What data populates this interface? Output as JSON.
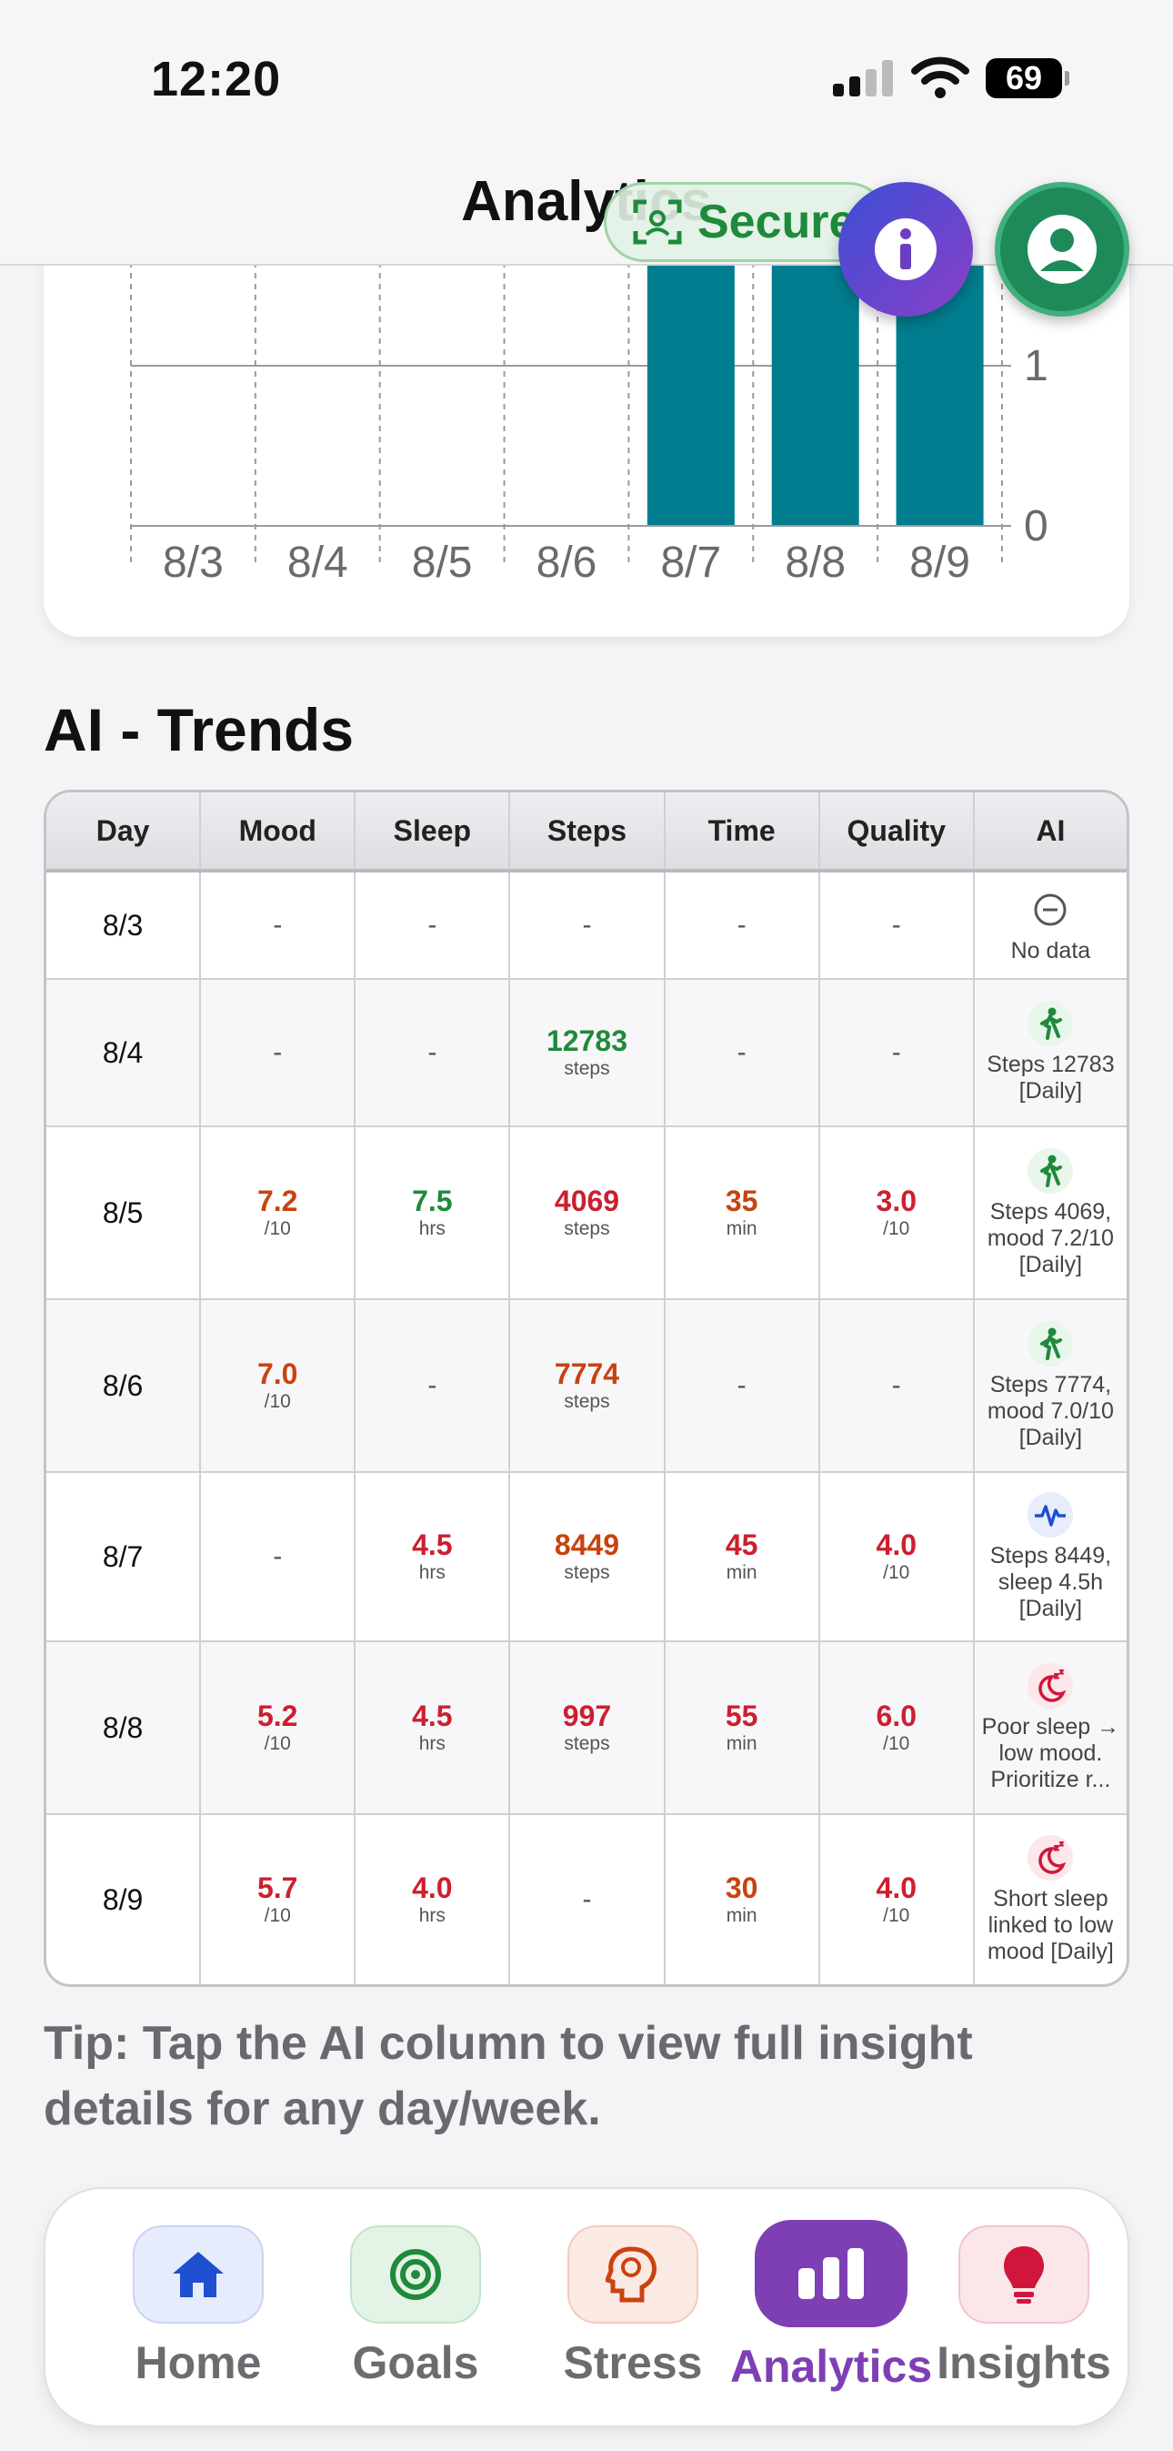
{
  "status_bar": {
    "time": "12:20",
    "battery": "69"
  },
  "header": {
    "title": "Analytics",
    "secure_label": "Secure"
  },
  "chart_data": {
    "type": "bar",
    "categories": [
      "8/3",
      "8/4",
      "8/5",
      "8/6",
      "8/7",
      "8/8",
      "8/9"
    ],
    "values": [
      0,
      0,
      0,
      0,
      2,
      2,
      2
    ],
    "y_ticks": [
      "0",
      "1"
    ],
    "ylim": [
      0,
      2
    ],
    "color": "#007d8f",
    "grid": true
  },
  "section_title": "AI - Trends",
  "table": {
    "headers": [
      "Day",
      "Mood",
      "Sleep",
      "Steps",
      "Time",
      "Quality",
      "AI"
    ],
    "rows": [
      {
        "day": "8/3",
        "mood": {
          "value": "-",
          "unit": "",
          "color": "dash"
        },
        "sleep": {
          "value": "-",
          "unit": "",
          "color": "dash"
        },
        "steps": {
          "value": "-",
          "unit": "",
          "color": "dash"
        },
        "time": {
          "value": "-",
          "unit": "",
          "color": "dash"
        },
        "quality": {
          "value": "-",
          "unit": "",
          "color": "dash"
        },
        "ai": {
          "icon": "no-data-icon",
          "text": "No data"
        }
      },
      {
        "day": "8/4",
        "mood": {
          "value": "-",
          "unit": "",
          "color": "dash"
        },
        "sleep": {
          "value": "-",
          "unit": "",
          "color": "dash"
        },
        "steps": {
          "value": "12783",
          "unit": "steps",
          "color": "green"
        },
        "time": {
          "value": "-",
          "unit": "",
          "color": "dash"
        },
        "quality": {
          "value": "-",
          "unit": "",
          "color": "dash"
        },
        "ai": {
          "icon": "walking-icon",
          "text": "Steps 12783 [Daily]"
        }
      },
      {
        "day": "8/5",
        "mood": {
          "value": "7.2",
          "unit": "/10",
          "color": "orange"
        },
        "sleep": {
          "value": "7.5",
          "unit": "hrs",
          "color": "green"
        },
        "steps": {
          "value": "4069",
          "unit": "steps",
          "color": "red"
        },
        "time": {
          "value": "35",
          "unit": "min",
          "color": "orange"
        },
        "quality": {
          "value": "3.0",
          "unit": "/10",
          "color": "red"
        },
        "ai": {
          "icon": "walking-icon",
          "text": "Steps 4069, mood 7.2/10 [Daily]"
        }
      },
      {
        "day": "8/6",
        "mood": {
          "value": "7.0",
          "unit": "/10",
          "color": "orange"
        },
        "sleep": {
          "value": "-",
          "unit": "",
          "color": "dash"
        },
        "steps": {
          "value": "7774",
          "unit": "steps",
          "color": "orange"
        },
        "time": {
          "value": "-",
          "unit": "",
          "color": "dash"
        },
        "quality": {
          "value": "-",
          "unit": "",
          "color": "dash"
        },
        "ai": {
          "icon": "walking-icon",
          "text": "Steps 7774, mood 7.0/10 [Daily]"
        }
      },
      {
        "day": "8/7",
        "mood": {
          "value": "-",
          "unit": "",
          "color": "dash"
        },
        "sleep": {
          "value": "4.5",
          "unit": "hrs",
          "color": "red"
        },
        "steps": {
          "value": "8449",
          "unit": "steps",
          "color": "orange"
        },
        "time": {
          "value": "45",
          "unit": "min",
          "color": "red"
        },
        "quality": {
          "value": "4.0",
          "unit": "/10",
          "color": "red"
        },
        "ai": {
          "icon": "pulse-icon",
          "text": "Steps 8449, sleep 4.5h [Daily]"
        }
      },
      {
        "day": "8/8",
        "mood": {
          "value": "5.2",
          "unit": "/10",
          "color": "red"
        },
        "sleep": {
          "value": "4.5",
          "unit": "hrs",
          "color": "red"
        },
        "steps": {
          "value": "997",
          "unit": "steps",
          "color": "red"
        },
        "time": {
          "value": "55",
          "unit": "min",
          "color": "red"
        },
        "quality": {
          "value": "6.0",
          "unit": "/10",
          "color": "red"
        },
        "ai": {
          "icon": "sleep-moon-icon",
          "text": "Poor sleep → low mood. Prioritize r..."
        }
      },
      {
        "day": "8/9",
        "mood": {
          "value": "5.7",
          "unit": "/10",
          "color": "red"
        },
        "sleep": {
          "value": "4.0",
          "unit": "hrs",
          "color": "red"
        },
        "steps": {
          "value": "-",
          "unit": "",
          "color": "dash"
        },
        "time": {
          "value": "30",
          "unit": "min",
          "color": "orange"
        },
        "quality": {
          "value": "4.0",
          "unit": "/10",
          "color": "red"
        },
        "ai": {
          "icon": "sleep-moon-icon",
          "text": "Short sleep linked to low mood [Daily]"
        }
      }
    ]
  },
  "tip": "Tip: Tap the AI column to view full insight details for any day/week.",
  "nav": {
    "home": "Home",
    "goals": "Goals",
    "stress": "Stress",
    "analytics": "Analytics",
    "insights": "Insights"
  },
  "colors": {
    "bar": "#007d8f",
    "accent": "#7e3fb5",
    "red": "#cc1f2f",
    "orange": "#c8430f",
    "green": "#1f8a3a"
  }
}
